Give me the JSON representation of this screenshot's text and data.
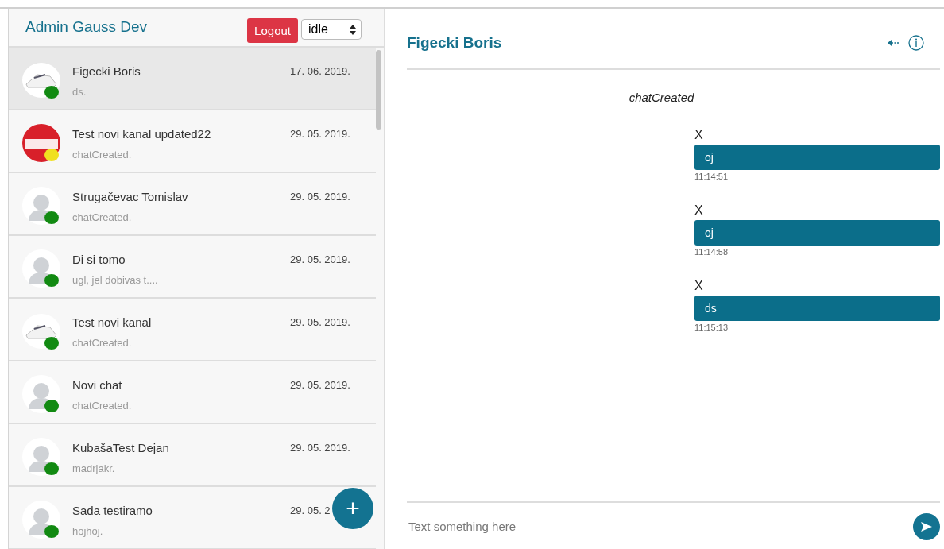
{
  "sidebar": {
    "title": "Admin Gauss Dev",
    "logout_button": "Logout",
    "status_select": {
      "value": "idle"
    },
    "chats": [
      {
        "name": "Figecki Boris",
        "date": "17. 06. 2019.",
        "preview": "ds.",
        "avatar": {
          "kind": "shoe"
        },
        "color": "#128a12",
        "selected": true
      },
      {
        "name": "Test novi kanal updated22",
        "date": "29. 05. 2019.",
        "preview": "chatCreated.",
        "avatar": {
          "kind": "test"
        },
        "color": "#f0e020",
        "selected": false
      },
      {
        "name": "Strugačevac Tomislav",
        "date": "29. 05. 2019.",
        "preview": "chatCreated.",
        "avatar": {
          "kind": "default"
        },
        "color": "#128a12",
        "selected": false
      },
      {
        "name": "Di si tomo",
        "date": "29. 05. 2019.",
        "preview": "ugl, jel dobivas t....",
        "avatar": {
          "kind": "default"
        },
        "color": "#128a12",
        "selected": false
      },
      {
        "name": "Test novi kanal",
        "date": "29. 05. 2019.",
        "preview": "chatCreated.",
        "avatar": {
          "kind": "shoe"
        },
        "color": "#128a12",
        "selected": false
      },
      {
        "name": "Novi chat",
        "date": "29. 05. 2019.",
        "preview": "chatCreated.",
        "avatar": {
          "kind": "default"
        },
        "color": "#128a12",
        "selected": false
      },
      {
        "name": "KubašaTest Dejan",
        "date": "29. 05. 2019.",
        "preview": "madrjakr.",
        "avatar": {
          "kind": "default"
        },
        "color": "#128a12",
        "selected": false
      },
      {
        "name": "Sada testiramo",
        "date": "29. 05. 2",
        "preview": "hojhoj.",
        "avatar": {
          "kind": "default"
        },
        "color": "#128a12",
        "selected": false
      }
    ],
    "new_chat_button": "+"
  },
  "conversation": {
    "title": "Figecki Boris",
    "messages": [
      {
        "kind": "system",
        "text": "chatCreated"
      },
      {
        "kind": "message",
        "sender": "X",
        "text": "oj",
        "time": "11:14:51"
      },
      {
        "kind": "message",
        "sender": "X",
        "text": "oj",
        "time": "11:14:58"
      },
      {
        "kind": "message",
        "sender": "X",
        "text": "ds",
        "time": "11:15:13"
      }
    ],
    "composer": {
      "placeholder": "Text something here"
    }
  }
}
